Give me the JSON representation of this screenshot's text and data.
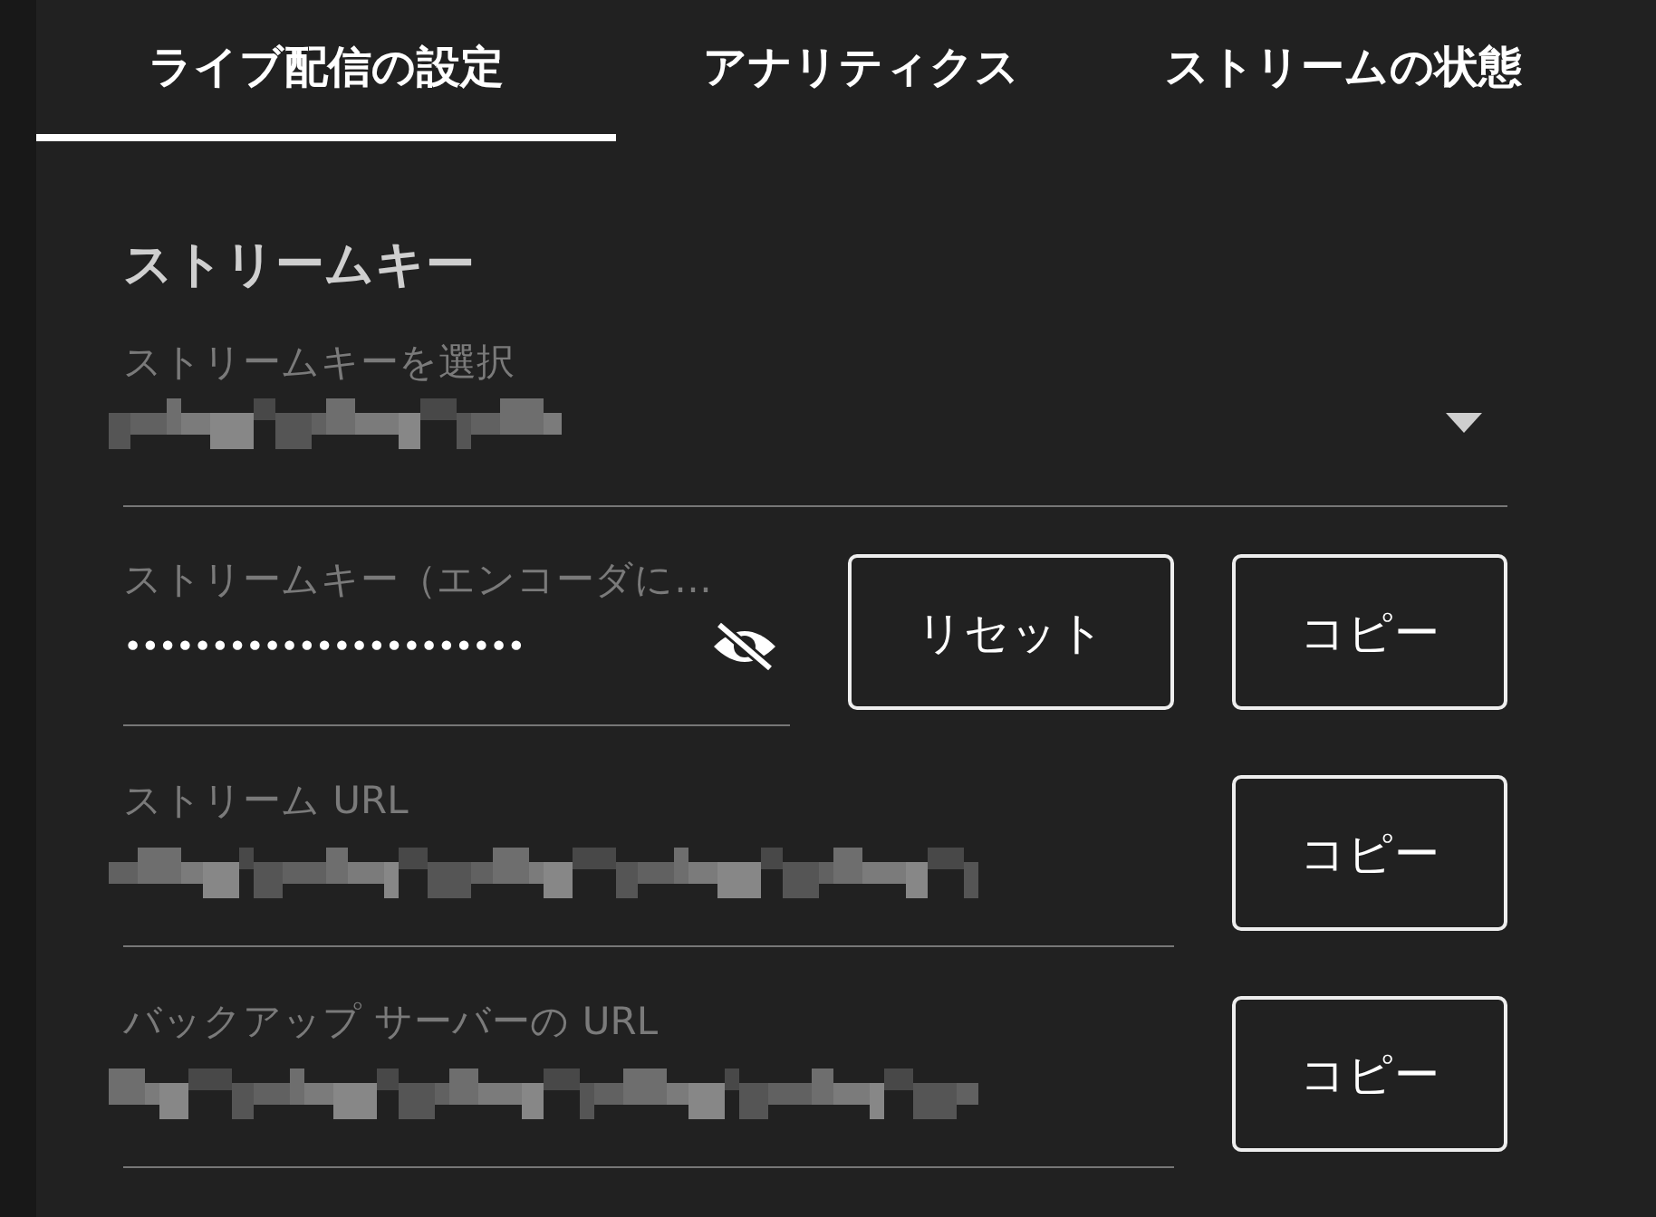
{
  "tabs": [
    {
      "label": "ライブ配信の設定",
      "selected": true
    },
    {
      "label": "アナリティクス",
      "selected": false
    },
    {
      "label": "ストリームの状態",
      "selected": false
    }
  ],
  "section_title": "ストリームキー",
  "key_select": {
    "label": "ストリームキーを選択"
  },
  "key_field": {
    "label": "ストリームキー（エンコーダに…",
    "value": "•••••••••••••••••••••••",
    "reset_button": "リセット",
    "copy_button": "コピー"
  },
  "url_fields": [
    {
      "label": "ストリーム URL",
      "copy_button": "コピー"
    },
    {
      "label": "バックアップ サーバーの URL",
      "copy_button": "コピー"
    }
  ]
}
